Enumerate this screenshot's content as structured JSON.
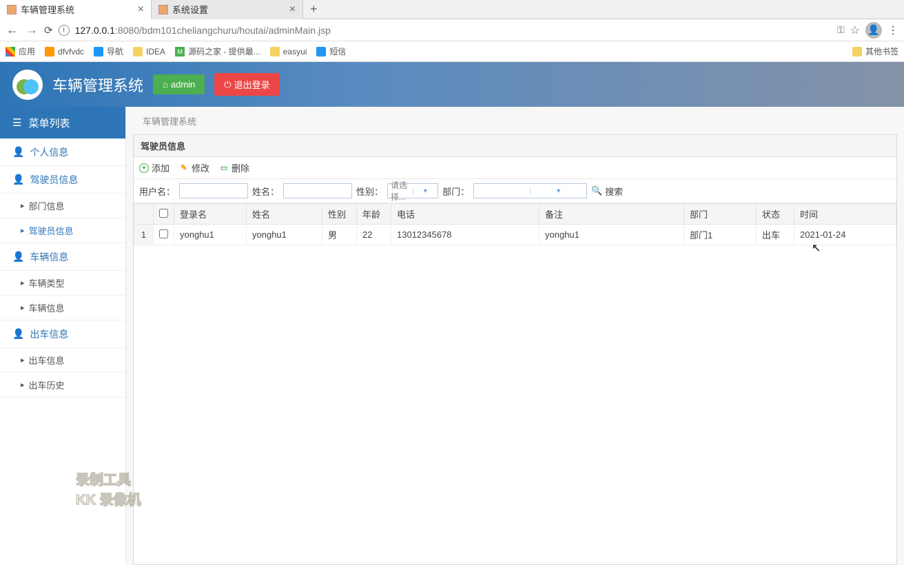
{
  "browser": {
    "tabs": [
      {
        "title": "车辆管理系统"
      },
      {
        "title": "系统设置"
      }
    ],
    "url_host": "127.0.0.1",
    "url_port": ":8080",
    "url_path": "/bdm101cheliangchuru/houtai/adminMain.jsp"
  },
  "bookmarks": {
    "apps": "应用",
    "items": [
      "dfvfvdc",
      "导航",
      "IDEA",
      "源码之家 - 提供最...",
      "easyui",
      "短信"
    ],
    "m_label": "M",
    "other": "其他书签"
  },
  "header": {
    "title": "车辆管理系统",
    "admin_btn": "admin",
    "logout_btn": "退出登录"
  },
  "sidebar": {
    "menu_title": "菜单列表",
    "sections": [
      {
        "label": "个人信息",
        "subs": []
      },
      {
        "label": "驾驶员信息",
        "subs": [
          "部门信息",
          "驾驶员信息"
        ],
        "active_sub": 1
      },
      {
        "label": "车辆信息",
        "subs": [
          "车辆类型",
          "车辆信息"
        ]
      },
      {
        "label": "出车信息",
        "subs": [
          "出车信息",
          "出车历史"
        ]
      }
    ]
  },
  "breadcrumb": "车辆管理系统",
  "panel": {
    "title": "驾驶员信息",
    "toolbar": {
      "add": "添加",
      "edit": "修改",
      "del": "删除"
    },
    "search": {
      "username_label": "用户名：",
      "name_label": "姓名：",
      "gender_label": "性别：",
      "gender_placeholder": "请选择...",
      "dept_label": "部门：",
      "search_btn": "搜索"
    },
    "columns": [
      "登录名",
      "姓名",
      "性别",
      "年龄",
      "电话",
      "备注",
      "部门",
      "状态",
      "时间"
    ],
    "rows": [
      {
        "num": "1",
        "login": "yonghu1",
        "name": "yonghu1",
        "gender": "男",
        "age": "22",
        "phone": "13012345678",
        "remark": "yonghu1",
        "dept": "部门1",
        "status": "出车",
        "time": "2021-01-24"
      }
    ]
  },
  "watermark": {
    "line1": "录制工具",
    "line2": "KK 录像机"
  }
}
